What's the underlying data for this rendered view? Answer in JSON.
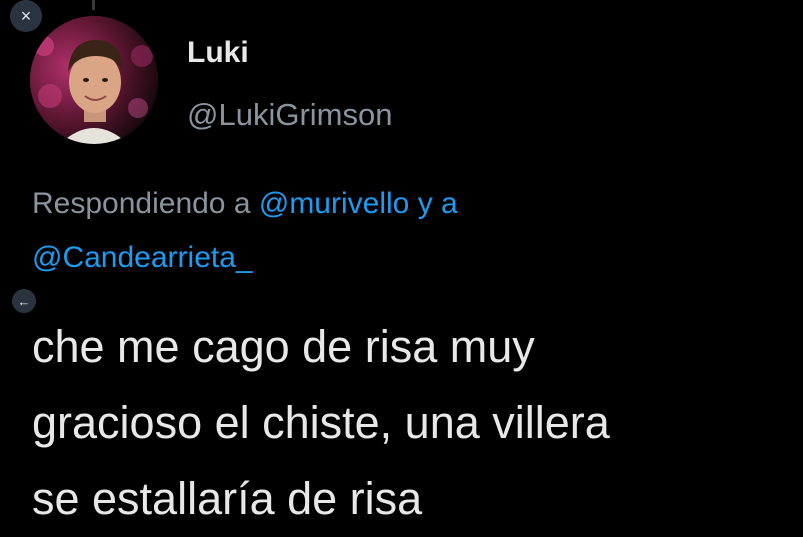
{
  "window": {
    "close_icon": "×",
    "back_icon": "←"
  },
  "author": {
    "display_name": "Luki",
    "handle": "@LukiGrimson",
    "avatar_icon": "profile-photo"
  },
  "reply": {
    "prefix": "Respondiendo a",
    "mention_1": "@murivello",
    "joiner": "y a",
    "mention_2": "@Candearrieta_"
  },
  "tweet": {
    "lines": [
      "che me cago de risa muy",
      "gracioso el chiste, una villera",
      "se estallaría de risa"
    ]
  },
  "colors": {
    "background": "#000000",
    "mention": "#1d9bf0",
    "muted": "#8a949e",
    "text": "#e8e8e8",
    "button_bg": "#2a3440"
  }
}
